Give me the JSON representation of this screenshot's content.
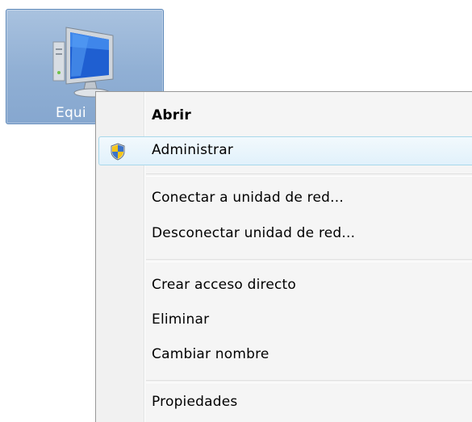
{
  "desktop": {
    "icon": {
      "label": "Equi",
      "icon_name": "computer-monitor-icon"
    }
  },
  "context_menu": {
    "items": [
      {
        "label": "Abrir",
        "bold": true
      },
      {
        "label": "Administrar",
        "icon_name": "uac-shield-icon",
        "hovered": true
      },
      {
        "label": "Conectar a unidad de red..."
      },
      {
        "label": "Desconectar unidad de red..."
      },
      {
        "label": "Crear acceso directo"
      },
      {
        "label": "Eliminar"
      },
      {
        "label": "Cambiar nombre"
      },
      {
        "label": "Propiedades"
      }
    ]
  },
  "colors": {
    "icon_selection": "#90afd4",
    "menu_background": "#f5f5f5",
    "hover_border": "#a8d8eb",
    "hover_fill": "#e1f1fb"
  }
}
